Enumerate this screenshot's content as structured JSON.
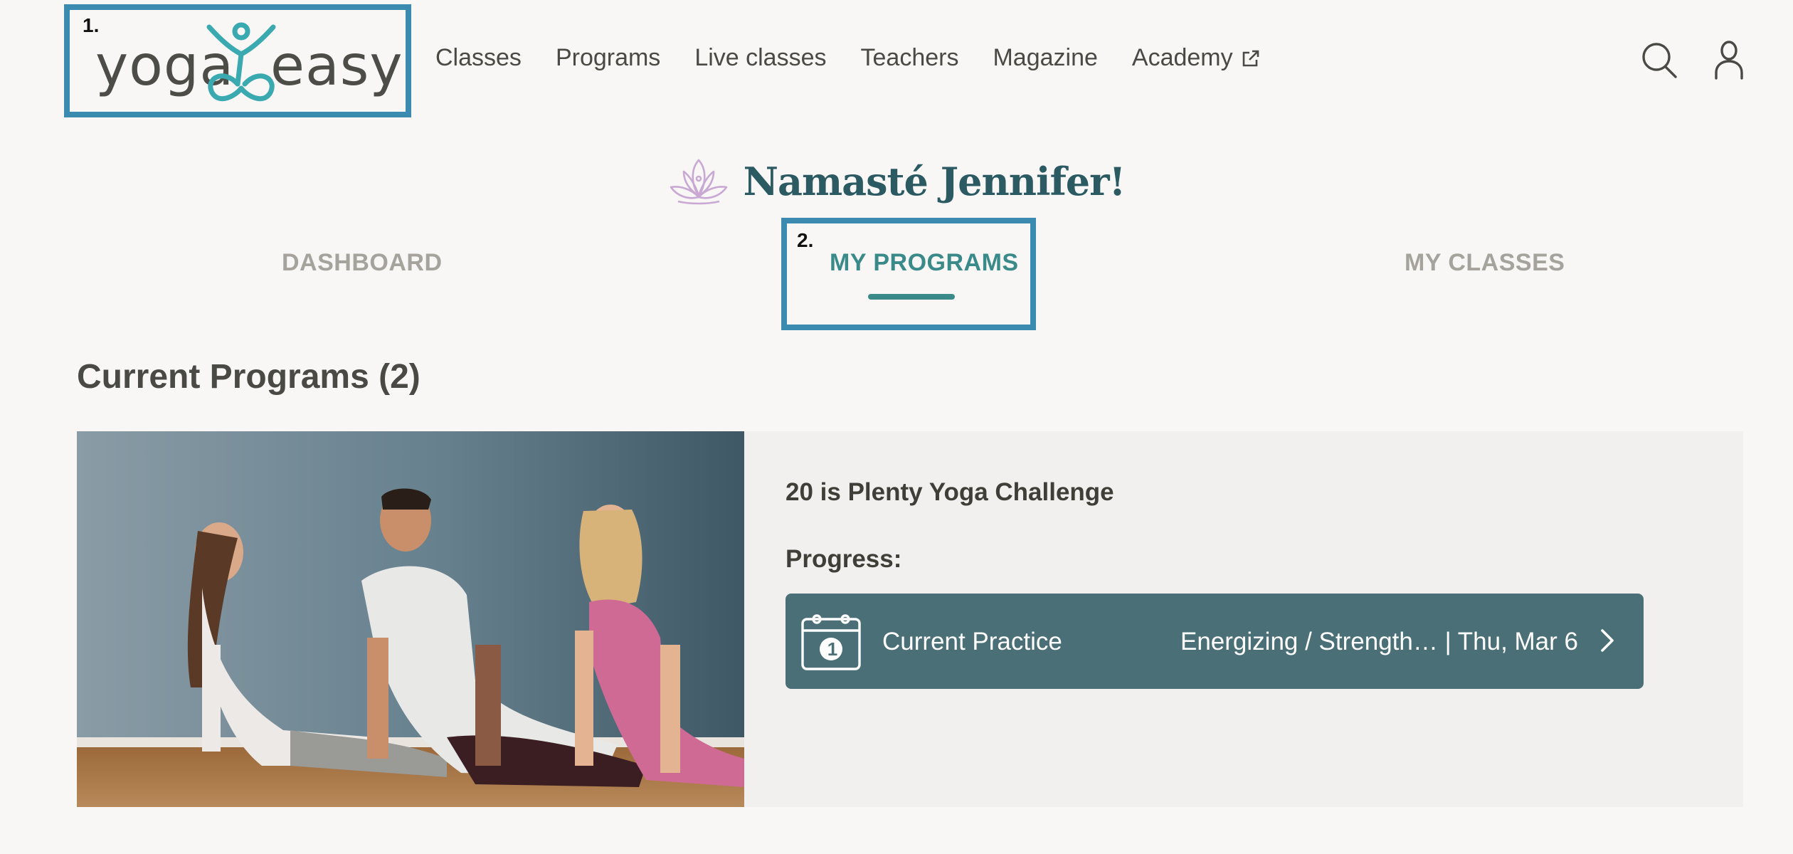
{
  "annotations": {
    "logo_marker": "1.",
    "tab_marker": "2."
  },
  "header": {
    "logo": {
      "left_text": "yoga",
      "right_text": "easy"
    },
    "nav": [
      {
        "label": "Classes"
      },
      {
        "label": "Programs"
      },
      {
        "label": "Live classes"
      },
      {
        "label": "Teachers"
      },
      {
        "label": "Magazine"
      },
      {
        "label": "Academy",
        "icon": "external-link-icon"
      }
    ],
    "icons": [
      "search-icon",
      "user-icon"
    ]
  },
  "greeting": {
    "text": "Namasté Jennifer!",
    "icon": "lotus-icon"
  },
  "tabs": [
    {
      "label": "DASHBOARD",
      "active": false
    },
    {
      "label": "MY PROGRAMS",
      "active": true
    },
    {
      "label": "MY CLASSES",
      "active": false
    }
  ],
  "section": {
    "title": "Current Programs (2)"
  },
  "program": {
    "title": "20 is Plenty Yoga Challenge",
    "progress_label": "Progress:",
    "current_practice": {
      "label": "Current Practice",
      "detail": "Energizing / Strength… | Thu, Mar 6",
      "day_number": "1",
      "icon": "calendar-icon"
    }
  },
  "colors": {
    "accent": "#3a8a8a",
    "logo_teal": "#3aa9b0",
    "heading": "#2b5a63",
    "practice_bar": "#4a6f77",
    "annotation_border": "#3b8ab0",
    "lotus": "#c9a8d4"
  }
}
